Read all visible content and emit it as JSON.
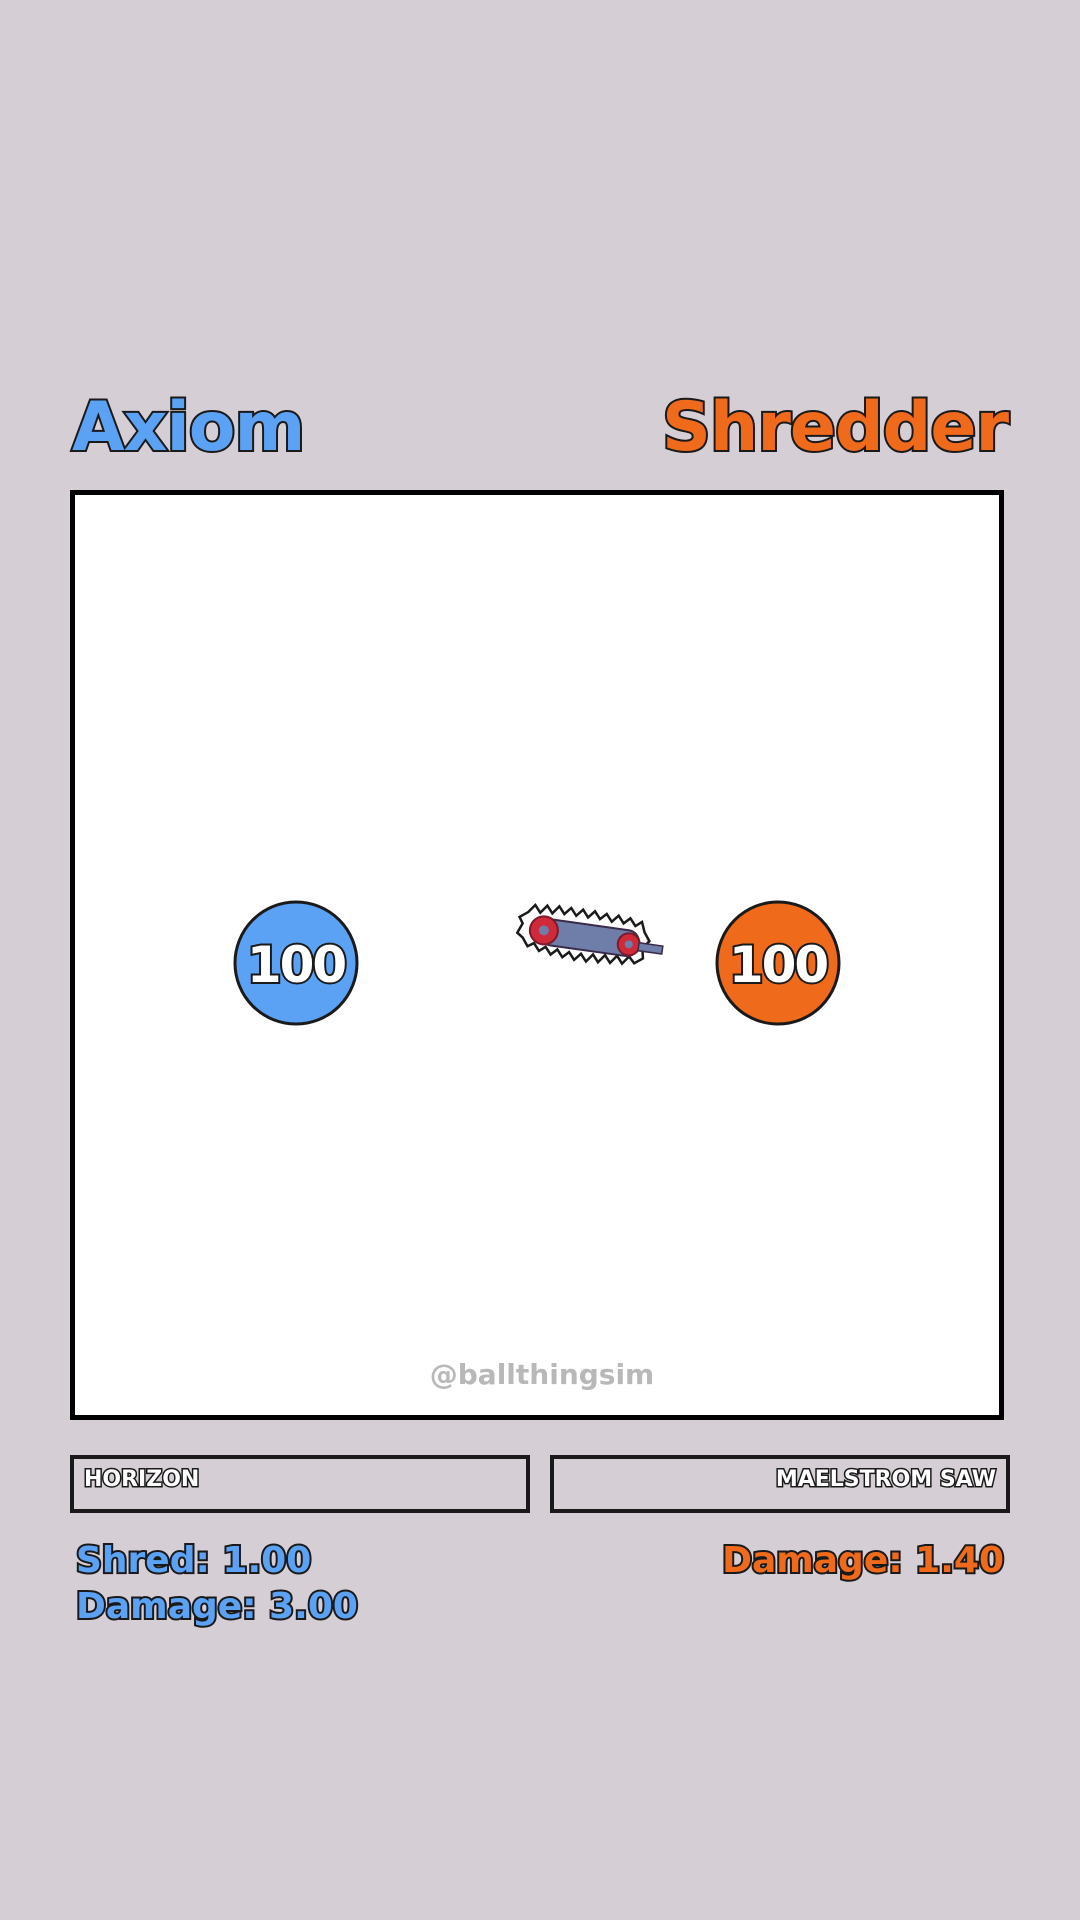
{
  "colors": {
    "background": "#d6ced5",
    "left_team": "#5ba2f5",
    "right_team": "#ef6a1a",
    "outline": "#1a1a1a"
  },
  "left": {
    "name": "Axiom",
    "hp": "100",
    "weapon": "HORIZON",
    "stats": [
      "Shred: 1.00",
      "Damage: 3.00"
    ]
  },
  "right": {
    "name": "Shredder",
    "hp": "100",
    "weapon": "MAELSTROM SAW",
    "weapon_icon": "chainsaw-icon",
    "stats": [
      "Damage: 1.40"
    ]
  },
  "watermark": "@ballthingsim"
}
